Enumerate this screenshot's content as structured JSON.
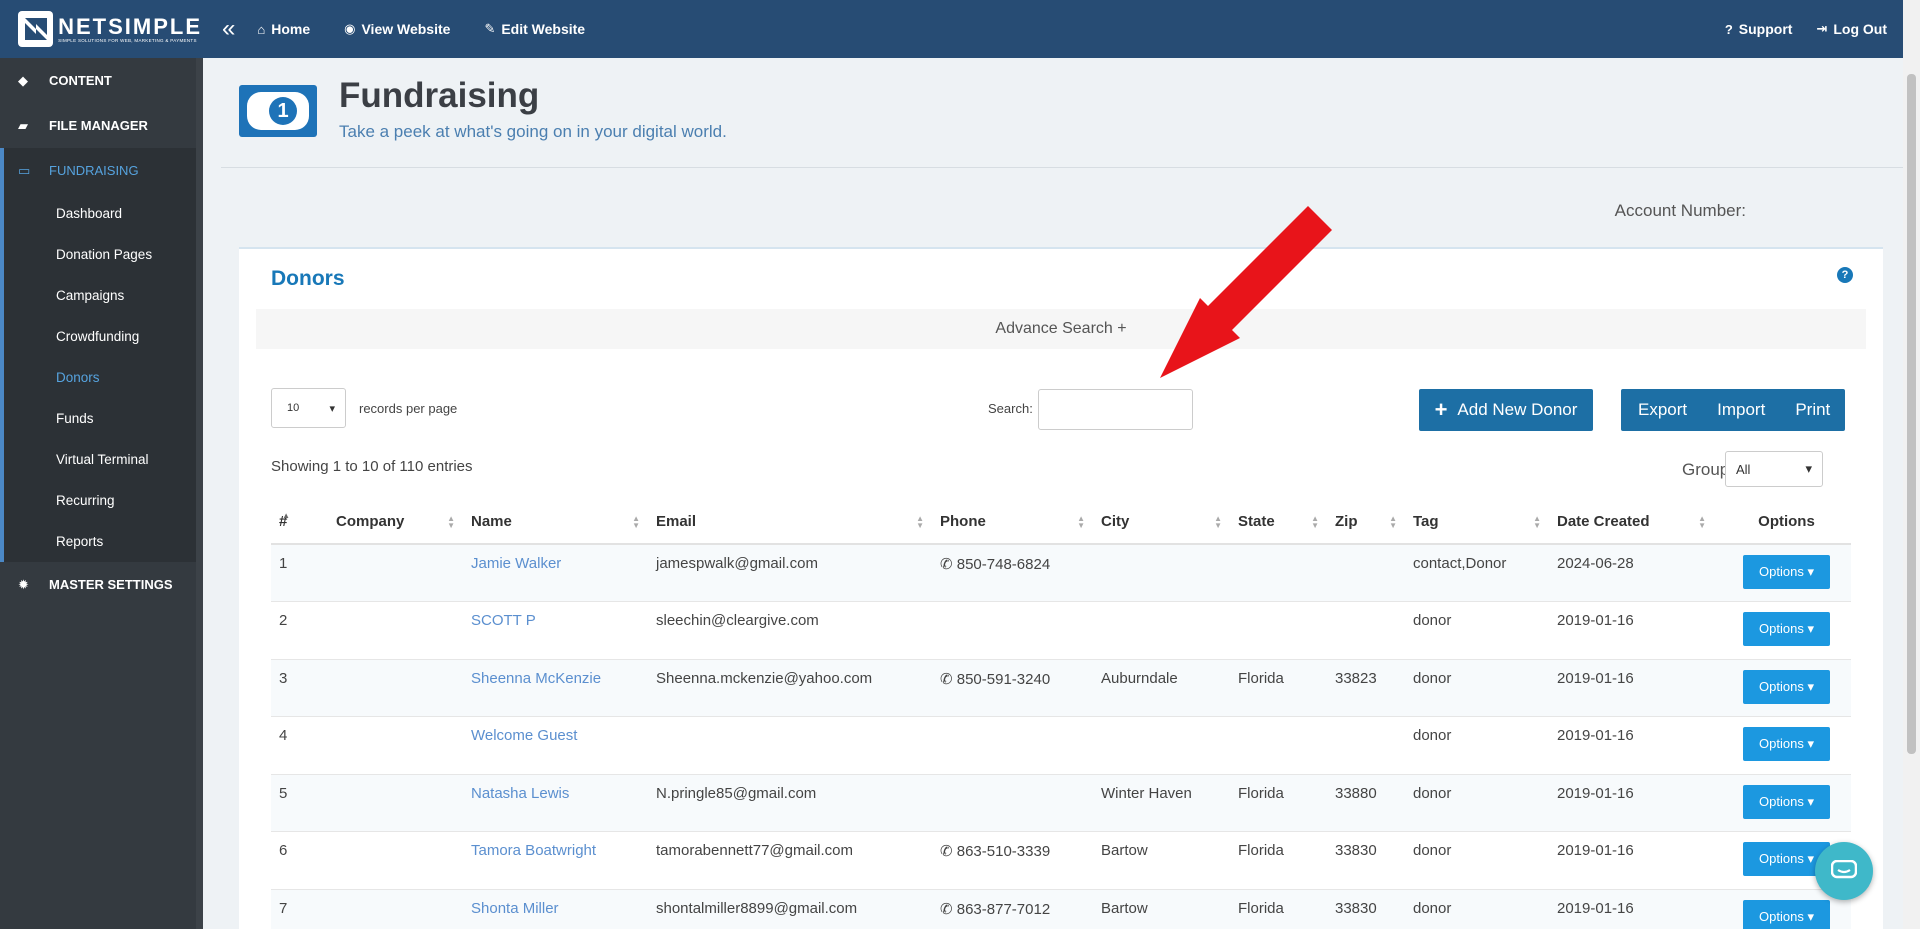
{
  "brand": {
    "name": "NETSIMPLE",
    "tagline": "SIMPLE SOLUTIONS FOR WEB, MARKETING & PAYMENTS"
  },
  "topnav": {
    "home": "Home",
    "view_website": "View Website",
    "edit_website": "Edit Website",
    "support": "Support",
    "logout": "Log Out"
  },
  "sidebar": {
    "content": "CONTENT",
    "file_manager": "FILE MANAGER",
    "fundraising": "FUNDRAISING",
    "sub_items": [
      "Dashboard",
      "Donation Pages",
      "Campaigns",
      "Crowdfunding",
      "Donors",
      "Funds",
      "Virtual Terminal",
      "Recurring",
      "Reports"
    ],
    "active_item": "Donors",
    "master_settings": "MASTER SETTINGS"
  },
  "header": {
    "title": "Fundraising",
    "subtitle": "Take a peek at what's going on in your digital world.",
    "icon_digit": "1",
    "account_label": "Account Number:"
  },
  "donors": {
    "title": "Donors",
    "advance_search": "Advance Search +",
    "records_per_page_value": "10",
    "records_per_page_label": "records per page",
    "search_label": "Search:",
    "search_value": "",
    "add_button": "Add New Donor",
    "export": "Export",
    "import": "Import",
    "print": "Print",
    "showing": "Showing 1 to 10 of 110 entries",
    "group_label": "Group",
    "group_value": "All",
    "columns": [
      "#",
      "Company",
      "Name",
      "Email",
      "Phone",
      "City",
      "State",
      "Zip",
      "Tag",
      "Date Created",
      "Options"
    ],
    "rows": [
      {
        "num": "1",
        "company": "",
        "name": "Jamie Walker",
        "email": "jamespwalk@gmail.com",
        "phone": "850-748-6824",
        "city": "",
        "state": "",
        "zip": "",
        "tag": "contact,Donor",
        "date": "2024-06-28"
      },
      {
        "num": "2",
        "company": "",
        "name": "SCOTT P",
        "email": "sleechin@cleargive.com",
        "phone": "",
        "city": "",
        "state": "",
        "zip": "",
        "tag": "donor",
        "date": "2019-01-16"
      },
      {
        "num": "3",
        "company": "",
        "name": "Sheenna McKenzie",
        "email": "Sheenna.mckenzie@yahoo.com",
        "phone": "850-591-3240",
        "city": "Auburndale",
        "state": "Florida",
        "zip": "33823",
        "tag": "donor",
        "date": "2019-01-16"
      },
      {
        "num": "4",
        "company": "",
        "name": "Welcome Guest",
        "email": "",
        "phone": "",
        "city": "",
        "state": "",
        "zip": "",
        "tag": "donor",
        "date": "2019-01-16"
      },
      {
        "num": "5",
        "company": "",
        "name": "Natasha Lewis",
        "email": "N.pringle85@gmail.com",
        "phone": "",
        "city": "Winter Haven",
        "state": "Florida",
        "zip": "33880",
        "tag": "donor",
        "date": "2019-01-16"
      },
      {
        "num": "6",
        "company": "",
        "name": "Tamora Boatwright",
        "email": "tamorabennett77@gmail.com",
        "phone": "863-510-3339",
        "city": "Bartow",
        "state": "Florida",
        "zip": "33830",
        "tag": "donor",
        "date": "2019-01-16"
      },
      {
        "num": "7",
        "company": "",
        "name": "Shonta Miller",
        "email": "shontalmiller8899@gmail.com",
        "phone": "863-877-7012",
        "city": "Bartow",
        "state": "Florida",
        "zip": "33830",
        "tag": "donor",
        "date": "2019-01-16"
      }
    ],
    "options_label": "Options"
  },
  "colors": {
    "topbar": "#274c74",
    "sidebar": "#343a40",
    "accent": "#1878b8",
    "options_button": "#1c98e0",
    "arrow": "#e8141a"
  }
}
